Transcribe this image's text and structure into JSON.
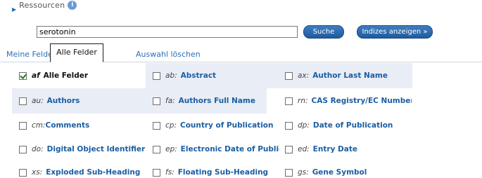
{
  "resources": {
    "label": "Ressourcen",
    "info_icon": "i"
  },
  "search": {
    "value": "serotonin",
    "search_label": "Suche",
    "indices_label": "Indizes anzeigen »"
  },
  "tabs": {
    "mine": "Meine Felder",
    "all": "Alle Felder",
    "clear": "Auswahl löschen"
  },
  "fields": [
    {
      "code": "af",
      "name": "Alle Felder",
      "checked": true
    },
    {
      "code": "ab:",
      "name": "Abstract",
      "checked": false
    },
    {
      "code": "ax:",
      "name": "Author Last Name",
      "checked": false
    },
    {
      "code": "au:",
      "name": "Authors",
      "checked": false
    },
    {
      "code": "fa:",
      "name": "Authors Full Name",
      "checked": false
    },
    {
      "code": "rn:",
      "name": "CAS Registry/EC Number/Nam",
      "checked": false
    },
    {
      "code": "cm:",
      "name": "Comments",
      "checked": false
    },
    {
      "code": "cp:",
      "name": "Country of Publication",
      "checked": false
    },
    {
      "code": "dp:",
      "name": "Date of Publication",
      "checked": false
    },
    {
      "code": "do:",
      "name": "Digital Object Identifier",
      "checked": false
    },
    {
      "code": "ep:",
      "name": "Electronic Date of Publicatio",
      "checked": false
    },
    {
      "code": "ed:",
      "name": "Entry Date",
      "checked": false
    },
    {
      "code": "xs:",
      "name": "Exploded Sub-Heading",
      "checked": false
    },
    {
      "code": "fs:",
      "name": "Floating Sub-Heading",
      "checked": false
    },
    {
      "code": "gs:",
      "name": "Gene Symbol",
      "checked": false
    }
  ]
}
